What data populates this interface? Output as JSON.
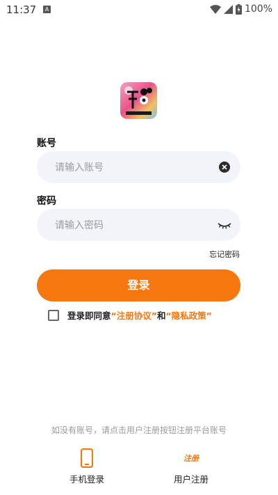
{
  "status_bar": {
    "time": "11:37",
    "badge": "A",
    "battery_text": "100%"
  },
  "login": {
    "account_label": "账号",
    "account_placeholder": "请输入账号",
    "password_label": "密码",
    "password_placeholder": "请输入密码",
    "forgot_password": "忘记密码",
    "login_button": "登录",
    "agreement_prefix": "登录即同意 ",
    "agreement_terms": "“注册协议”",
    "agreement_and": " 和 ",
    "agreement_privacy": "“隐私政策”"
  },
  "footer": {
    "hint": "如没有账号，请点击用户注册按钮注册平台账号",
    "phone_login": "手机登录",
    "register_icon_text": "注册",
    "user_register": "用户注册"
  },
  "colors": {
    "accent": "#f7770f",
    "field_bg": "#f3f4f9"
  }
}
